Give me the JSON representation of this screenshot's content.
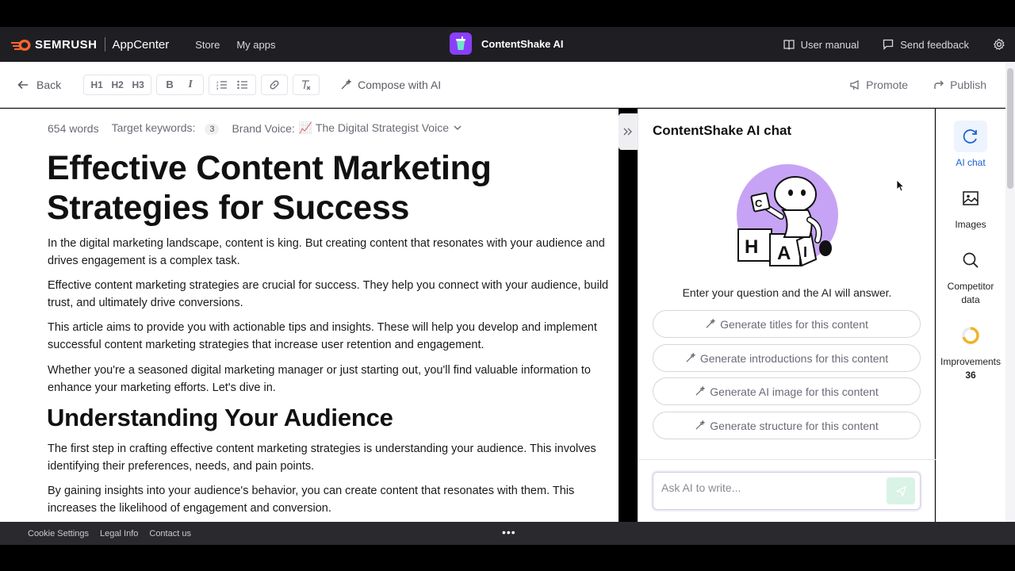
{
  "topbar": {
    "brand_name": "SEMRUSH",
    "brand_app": "AppCenter",
    "nav": [
      "Store",
      "My apps"
    ],
    "app_name": "ContentShake AI",
    "user_manual": "User manual",
    "send_feedback": "Send feedback",
    "accent_color": "#ff642d",
    "app_icon_color": "#8a3ffc"
  },
  "toolbar": {
    "back": "Back",
    "formats": [
      "H1",
      "H2",
      "H3"
    ],
    "compose": "Compose with AI",
    "promote": "Promote",
    "publish": "Publish"
  },
  "editor": {
    "word_count": "654 words",
    "target_keywords_label": "Target keywords:",
    "target_keywords_count": "3",
    "brand_voice_label": "Brand Voice:",
    "brand_voice_value": "📈 The Digital Strategist Voice",
    "title": "Effective Content Marketing Strategies for Success",
    "paragraphs": [
      "In the digital marketing landscape, content is king. But creating content that resonates with your audience and drives engagement is a complex task.",
      "Effective content marketing strategies are crucial for success. They help you connect with your audience, build trust, and ultimately drive conversions.",
      "This article aims to provide you with actionable tips and insights. These will help you develop and implement successful content marketing strategies that increase user retention and engagement.",
      "Whether you're a seasoned digital marketing manager or just starting out, you'll find valuable information to enhance your marketing efforts. Let's dive in."
    ],
    "subheading": "Understanding Your Audience",
    "paragraphs2": [
      "The first step in crafting effective content marketing strategies is understanding your audience. This involves identifying their preferences, needs, and pain points.",
      "By gaining insights into your audience's behavior, you can create content that resonates with them. This increases the likelihood of engagement and conversion."
    ]
  },
  "chat": {
    "title": "ContentShake AI chat",
    "hint": "Enter your question and the AI will answer.",
    "suggestions": [
      "Generate titles for this content",
      "Generate introductions for this content",
      "Generate AI image for this content",
      "Generate structure for this content"
    ],
    "input_placeholder": "Ask AI to write..."
  },
  "rail": {
    "ai_chat": "AI chat",
    "images": "Images",
    "competitor_line1": "Competitor",
    "competitor_line2": "data",
    "improvements": "Improvements",
    "improvements_count": "36"
  },
  "footer": {
    "links": [
      "Cookie Settings",
      "Legal Info",
      "Contact us"
    ],
    "dots": "•••"
  }
}
